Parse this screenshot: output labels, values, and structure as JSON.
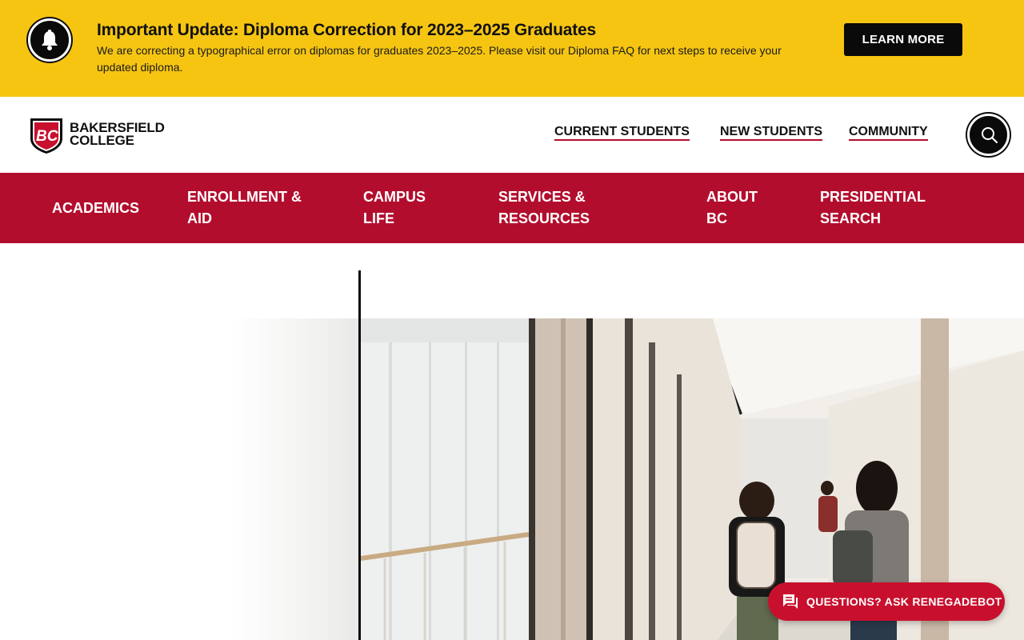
{
  "alert": {
    "icon": "bell-icon",
    "title": "Important Update: Diploma Correction for 2023–2025 Graduates",
    "body": "We are correcting a typographical error on diplomas for graduates 2023–2025. Please visit our Diploma FAQ for next steps to receive your updated diploma.",
    "button_label": "LEARN MORE"
  },
  "header": {
    "logo_line1": "BAKERSFIELD",
    "logo_line2": "COLLEGE",
    "util_links": [
      "CURRENT STUDENTS",
      "NEW STUDENTS",
      "COMMUNITY"
    ],
    "search_icon": "search-icon"
  },
  "main_nav": {
    "items": [
      {
        "line1": "ACADEMICS",
        "line2": ""
      },
      {
        "line1": "ENROLLMENT &",
        "line2": "AID"
      },
      {
        "line1": "CAMPUS",
        "line2": "LIFE"
      },
      {
        "line1": "SERVICES &",
        "line2": "RESOURCES"
      },
      {
        "line1": "ABOUT",
        "line2": "BC"
      },
      {
        "line1": "PRESIDENTIAL",
        "line2": "SEARCH"
      }
    ]
  },
  "chat": {
    "icon": "chat-icon",
    "label": "QUESTIONS? ASK RENEGADEBOT"
  },
  "colors": {
    "banner": "#f6c512",
    "brand_red": "#b30d2d",
    "black": "#0a0a0a"
  }
}
